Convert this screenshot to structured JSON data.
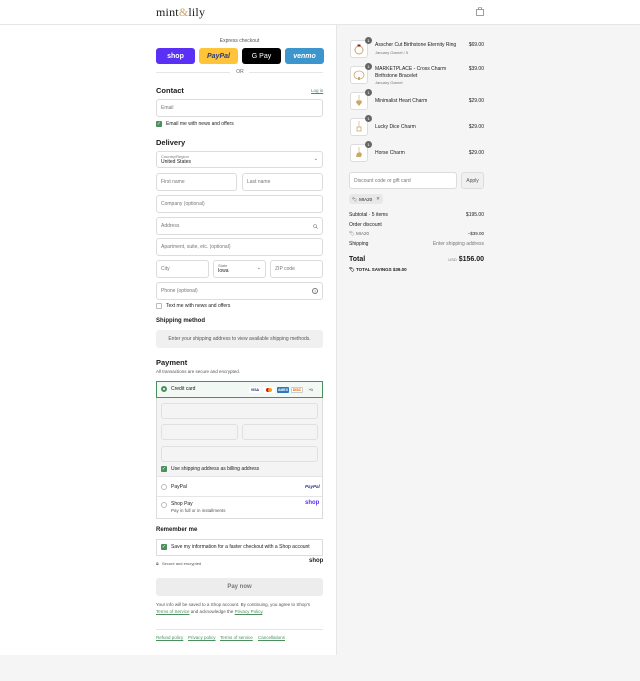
{
  "header": {
    "logo_left": "mint",
    "logo_amp": "&",
    "logo_right": "lily"
  },
  "express": {
    "title": "Express checkout",
    "shop": "shop",
    "paypal": "PayPal",
    "gpay": "G Pay",
    "venmo": "venmo",
    "or": "OR"
  },
  "contact": {
    "heading": "Contact",
    "login": "Log in",
    "email_placeholder": "Email",
    "email_news": "Email me with news and offers"
  },
  "delivery": {
    "heading": "Delivery",
    "country_label": "Country/Region",
    "country_value": "United States",
    "first_name": "First name",
    "last_name": "Last name",
    "company": "Company (optional)",
    "address": "Address",
    "apartment": "Apartment, suite, etc. (optional)",
    "city": "City",
    "state_label": "State",
    "state_value": "Iowa",
    "zip": "ZIP code",
    "phone": "Phone (optional)",
    "text_news": "Text me with news and offers"
  },
  "shipping": {
    "heading": "Shipping method",
    "notice": "Enter your shipping address to view available shipping methods."
  },
  "payment": {
    "heading": "Payment",
    "sub": "All transactions are secure and encrypted.",
    "credit_card": "Credit card",
    "card_logos": [
      "VISA",
      "MC",
      "AMEX",
      "DISC",
      "+1"
    ],
    "billing_same": "Use shipping address as billing address",
    "paypal": "PayPal",
    "paypal_logo": "PayPal",
    "shop_pay": "Shop Pay",
    "shop_pay_sub": "Pay in full or in installments",
    "shop_pay_logo": "shop"
  },
  "remember": {
    "heading": "Remember me",
    "save_info": "Save my information for a faster checkout with a Shop account",
    "secure": "Secure and encrypted",
    "shop_logo": "shop"
  },
  "pay_now": "Pay now",
  "legal": {
    "text1": "Your info will be saved to a Shop account. By continuing, you agree to Shop's",
    "terms": "Terms of Service",
    "text2": "and acknowledge the",
    "privacy": "Privacy Policy",
    "end": "."
  },
  "footer_links": [
    "Refund policy",
    "Privacy policy",
    "Terms of service",
    "Cancellations"
  ],
  "cart": {
    "items": [
      {
        "name": "Asscher Cut Birthstone Eternity Ring",
        "variant": "January Garnet / 5",
        "price": "$69.00",
        "qty": "1"
      },
      {
        "name": "MARKETPLACE - Cross Charm Birthstone Bracelet",
        "variant": "January Garnet",
        "price": "$39.00",
        "qty": "1"
      },
      {
        "name": "Minimalist Heart Charm",
        "variant": "",
        "price": "$29.00",
        "qty": "1"
      },
      {
        "name": "Lucky Dice Charm",
        "variant": "",
        "price": "$29.00",
        "qty": "1"
      },
      {
        "name": "Horse Charm",
        "variant": "",
        "price": "$29.00",
        "qty": "1"
      }
    ],
    "discount_placeholder": "Discount code or gift card",
    "apply": "Apply",
    "code_tag": "MIA20",
    "subtotal_label": "Subtotal · 5 items",
    "subtotal_value": "$195.00",
    "order_discount_label": "Order discount",
    "discount_code": "MIA20",
    "discount_value": "−$39.00",
    "shipping_label": "Shipping",
    "shipping_value": "Enter shipping address",
    "total_label": "Total",
    "currency": "USD",
    "total_value": "$156.00",
    "savings_label": "TOTAL SAVINGS",
    "savings_value": "$39.00"
  },
  "colors": {
    "accent": "#4a8f5c",
    "shop": "#5a31f4",
    "paypal": "#ffc439",
    "venmo": "#3d95ce"
  }
}
